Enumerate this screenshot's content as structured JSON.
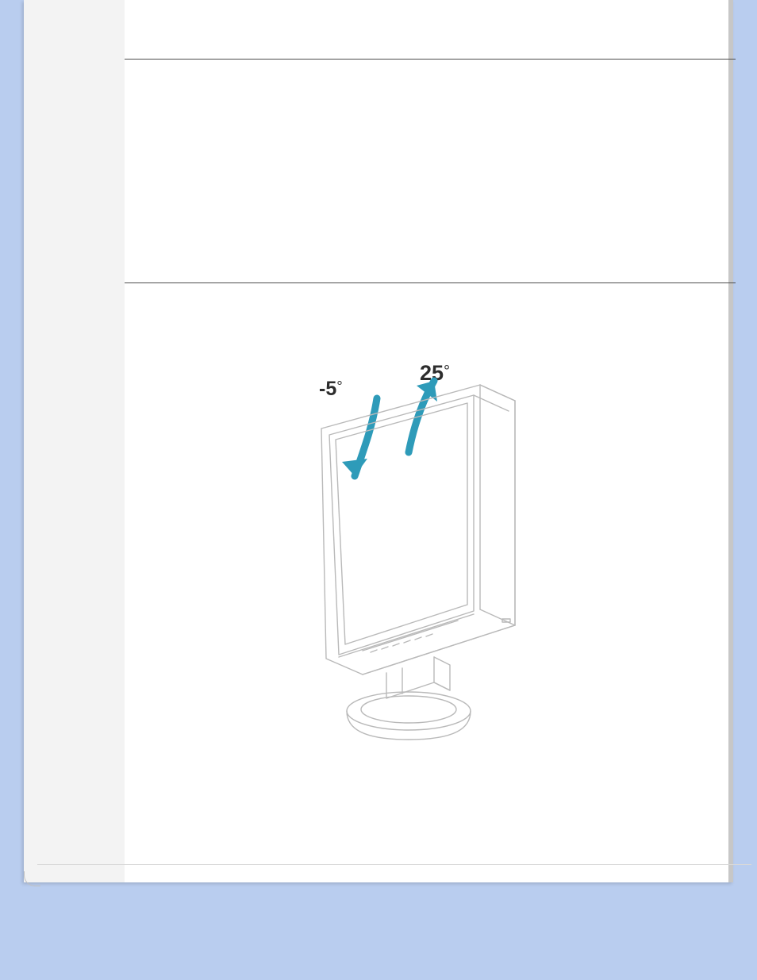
{
  "illustration": {
    "tilt_back_label": "-5",
    "tilt_forward_label": "25",
    "degree_symbol": "°"
  }
}
